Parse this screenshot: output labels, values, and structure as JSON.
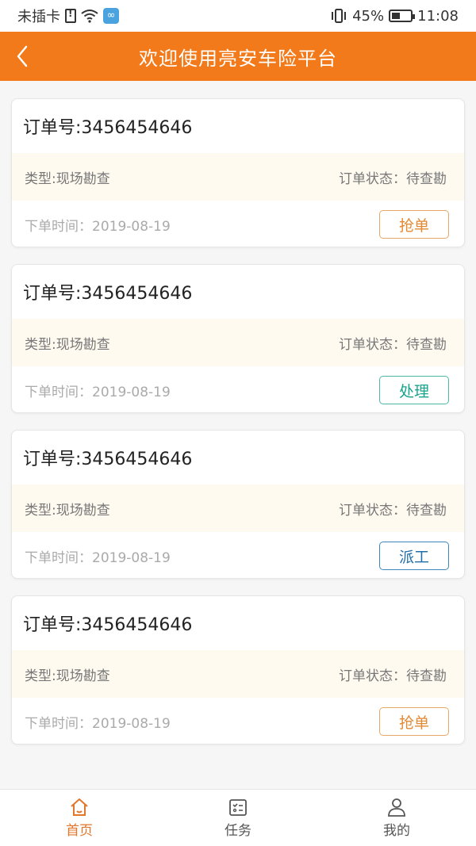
{
  "status_bar": {
    "carrier": "未插卡",
    "battery_percent": "45%",
    "battery_level": 0.45,
    "time": "11:08",
    "icons": [
      "sim-warning-icon",
      "wifi-icon",
      "app-badge-icon",
      "vibrate-icon",
      "battery-icon"
    ]
  },
  "header": {
    "title": "欢迎使用亮安车险平台",
    "back_icon": "chevron-left-icon",
    "color": "#f27a1a"
  },
  "orders": [
    {
      "order_no": "订单号:3456454646",
      "type": "类型:现场勘查",
      "status": "订单状态：待查勘",
      "time": "下单时间：2019-08-19",
      "action": "抢单",
      "action_color": "#e28a33"
    },
    {
      "order_no": "订单号:3456454646",
      "type": "类型:现场勘查",
      "status": "订单状态：待查勘",
      "time": "下单时间：2019-08-19",
      "action": "处理",
      "action_color": "#17a38c"
    },
    {
      "order_no": "订单号:3456454646",
      "type": "类型:现场勘查",
      "status": "订单状态：待查勘",
      "time": "下单时间：2019-08-19",
      "action": "派工",
      "action_color": "#1f6ea7"
    },
    {
      "order_no": "订单号:3456454646",
      "type": "类型:现场勘查",
      "status": "订单状态：待查勘",
      "time": "下单时间：2019-08-19",
      "action": "抢单",
      "action_color": "#e28a33"
    }
  ],
  "bottom_nav": {
    "items": [
      {
        "label": "首页",
        "icon": "home-icon",
        "active": true
      },
      {
        "label": "任务",
        "icon": "task-list-icon",
        "active": false
      },
      {
        "label": "我的",
        "icon": "user-icon",
        "active": false
      }
    ],
    "active_color": "#e2762a"
  }
}
